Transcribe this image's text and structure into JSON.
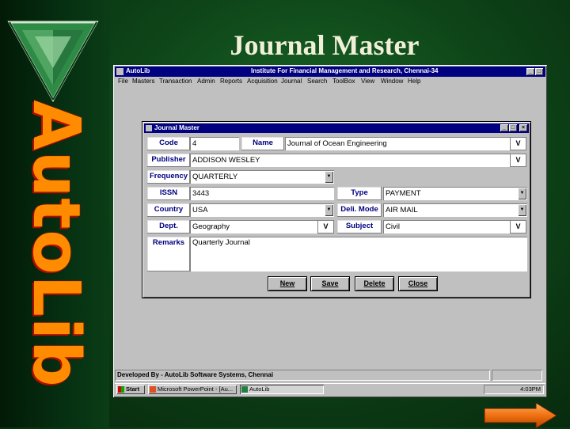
{
  "slide": {
    "title": "Journal Master",
    "vertical_logo_text": "AutoLib",
    "accent_color": "#ff8c00"
  },
  "app_window": {
    "title": "AutoLib",
    "caption_center": "Institute For Financial Management and Research, Chennai-34",
    "menu": [
      "File",
      "Masters",
      "Transaction",
      "Admin",
      "Reports",
      "Acquisition",
      "Journal",
      "Search",
      "ToolBox",
      "View",
      "Window",
      "Help"
    ]
  },
  "dialog": {
    "title": "Journal Master",
    "labels": {
      "code": "Code",
      "name": "Name",
      "publisher": "Publisher",
      "frequency": "Frequency",
      "issn": "ISSN",
      "type": "Type",
      "country": "Country",
      "deli_mode": "Deli. Mode",
      "dept": "Dept.",
      "subject": "Subject",
      "remarks": "Remarks"
    },
    "values": {
      "code": "4",
      "name": "Journal of Ocean Engineering",
      "publisher": "ADDISON WESLEY",
      "frequency": "QUARTERLY",
      "issn": "3443",
      "type": "PAYMENT",
      "country": "USA",
      "deli_mode": "AIR MAIL",
      "dept": "Geography",
      "subject": "Civil",
      "remarks": "Quarterly Journal"
    },
    "lookup_button_label": "V",
    "buttons": {
      "new": "New",
      "save": "Save",
      "delete": "Delete",
      "close": "Close"
    }
  },
  "statusbar": {
    "text": "Developed By - AutoLib Software Systems, Chennai"
  },
  "taskbar": {
    "start": "Start",
    "items": [
      "Microsoft PowerPoint - [Au...",
      "AutoLib"
    ],
    "clock": "4:03PM"
  },
  "icons": [
    "autolib-logo-icon",
    "next-slide-arrow-icon",
    "minimize-icon",
    "maximize-icon",
    "close-icon",
    "dropdown-arrow-icon",
    "windows-start-icon"
  ]
}
